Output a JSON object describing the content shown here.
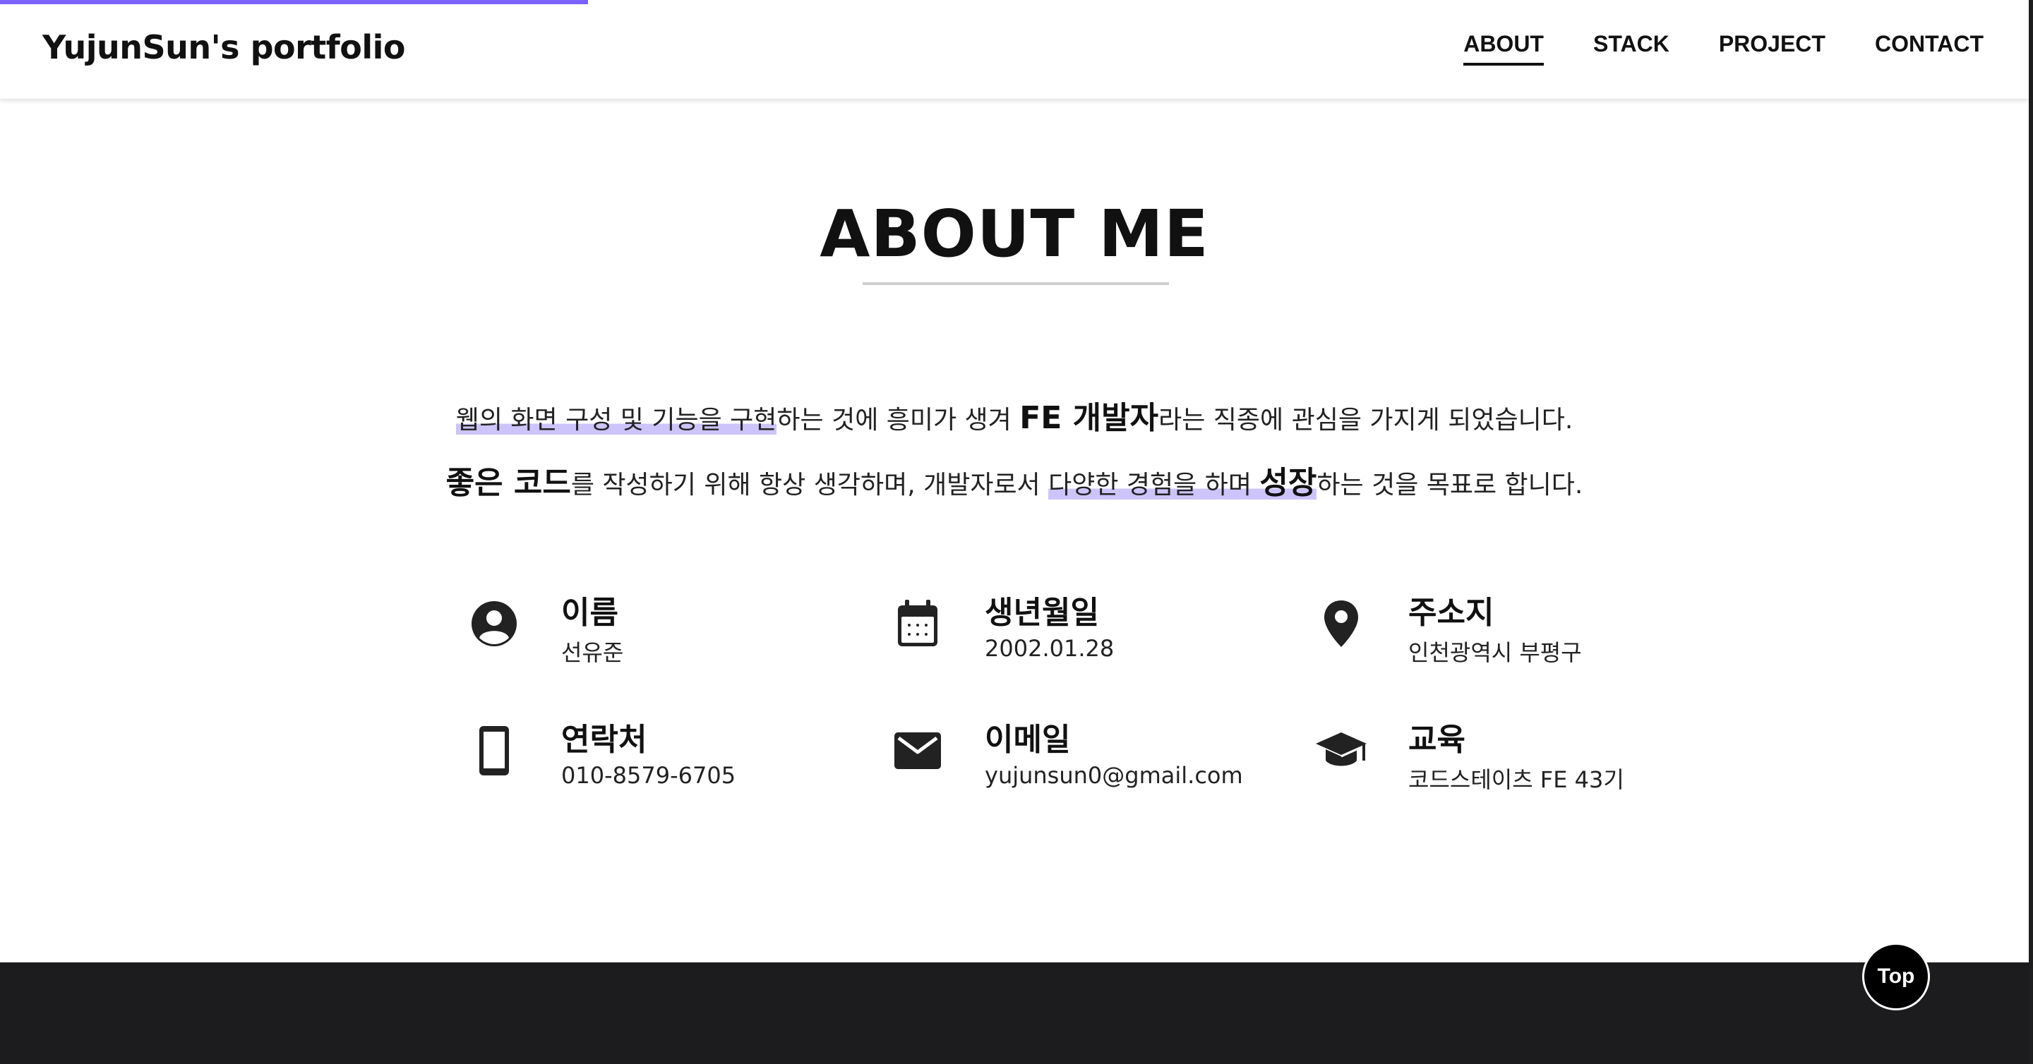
{
  "scroll_progress": 0.29,
  "brand": "YujunSun's portfolio",
  "nav": [
    "ABOUT",
    "STACK",
    "PROJECT",
    "CONTACT"
  ],
  "section_title": "ABOUT ME",
  "intro": {
    "line1": {
      "part1": "웹의 화면 구성 및 기능을 구현",
      "part2": "하는 것에 흥미가 생겨 ",
      "strong": "FE 개발자",
      "part3": "라는 직종에 관심을 가지게 되었습니다."
    },
    "line2": {
      "strong1": "좋은 코드",
      "part1": "를 작성하기 위해 항상 생각하며, 개발자로서 ",
      "part2": "다양한 경험을 하며 ",
      "strong2": "성장",
      "part3": "하는 것을 목표로 합니다."
    }
  },
  "info": [
    {
      "icon": "user-circle-icon",
      "label": "이름",
      "value": "선유준"
    },
    {
      "icon": "calendar-icon",
      "label": "생년월일",
      "value": "2002.01.28"
    },
    {
      "icon": "location-pin-icon",
      "label": "주소지",
      "value": "인천광역시 부평구"
    },
    {
      "icon": "mobile-phone-icon",
      "label": "연락처",
      "value": "010-8579-6705"
    },
    {
      "icon": "envelope-icon",
      "label": "이메일",
      "value": "yujunsun0@gmail.com"
    },
    {
      "icon": "graduation-cap-icon",
      "label": "교육",
      "value": "코드스테이츠 FE 43기"
    }
  ],
  "top_button": "Top",
  "colors": {
    "accent": "#7b61ff",
    "highlight": "#cdc4fb",
    "footer": "#1c1c1f",
    "text": "#111111"
  }
}
